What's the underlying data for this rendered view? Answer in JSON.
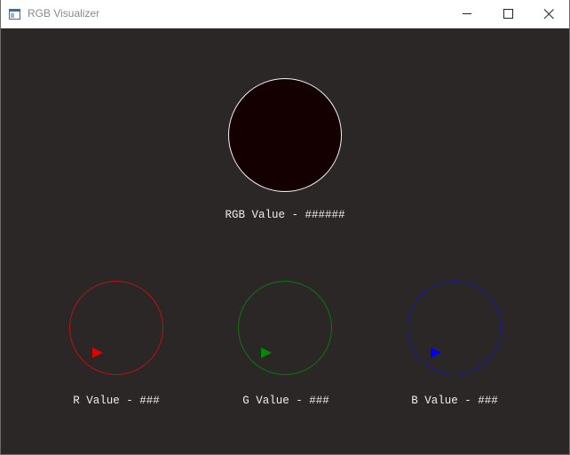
{
  "window": {
    "title": "RGB Visualizer",
    "icon": "app-window-icon",
    "controls": {
      "minimize_icon": "minimize-icon",
      "maximize_icon": "maximize-icon",
      "close_icon": "close-icon"
    }
  },
  "preview": {
    "color": "#140000",
    "label": "RGB Value - ######"
  },
  "dials": [
    {
      "channel": "R",
      "label": "R Value - ###",
      "color": "#b81414",
      "pointer_color": "#e00000"
    },
    {
      "channel": "G",
      "label": "G Value - ###",
      "color": "#137313",
      "pointer_color": "#008a00"
    },
    {
      "channel": "B",
      "label": "B Value - ###",
      "color": "#1a1aa6",
      "pointer_color": "#0000f0"
    }
  ],
  "colors": {
    "background": "#2a2726",
    "text": "#eeeeee",
    "preview_border": "#f4f4f4"
  }
}
